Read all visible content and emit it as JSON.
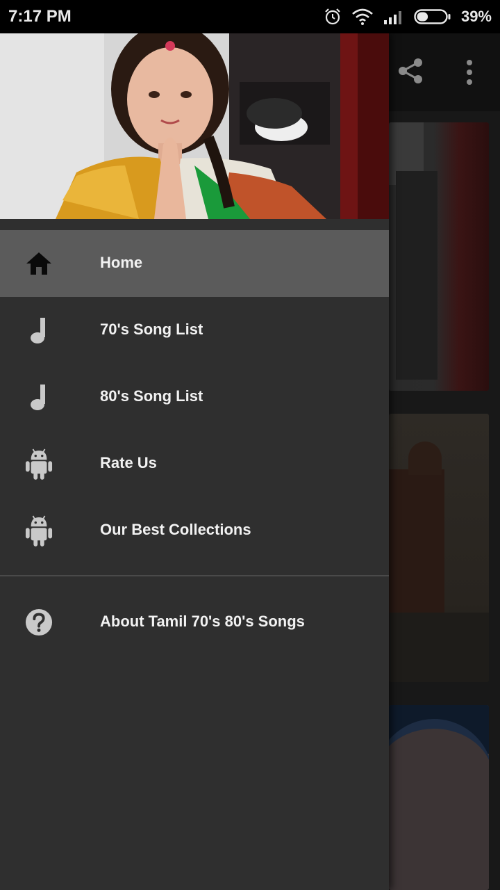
{
  "status_bar": {
    "time": "7:17 PM",
    "battery_percent": "39%",
    "battery_level": 0.39,
    "icons": [
      "alarm-icon",
      "wifi-icon",
      "signal-icon",
      "battery-icon"
    ]
  },
  "toolbar": {
    "icons": [
      "share-icon",
      "more-vert-icon"
    ]
  },
  "drawer": {
    "menu": [
      {
        "label": "Home",
        "icon": "home-icon",
        "active": true
      },
      {
        "label": "70's Song List",
        "icon": "music-note-icon",
        "active": false
      },
      {
        "label": "80's Song List",
        "icon": "music-note-icon",
        "active": false
      },
      {
        "label": "Rate Us",
        "icon": "android-icon",
        "active": false
      },
      {
        "label": "Our Best Collections",
        "icon": "android-icon",
        "active": false
      }
    ],
    "secondary": [
      {
        "label": "About Tamil 70's 80's Songs",
        "icon": "help-icon"
      }
    ]
  },
  "colors": {
    "drawer_bg": "#2f2f2f",
    "active_item_bg": "#5b5b5b",
    "text": "#f2f2f2",
    "status_bar_bg": "#000000"
  }
}
